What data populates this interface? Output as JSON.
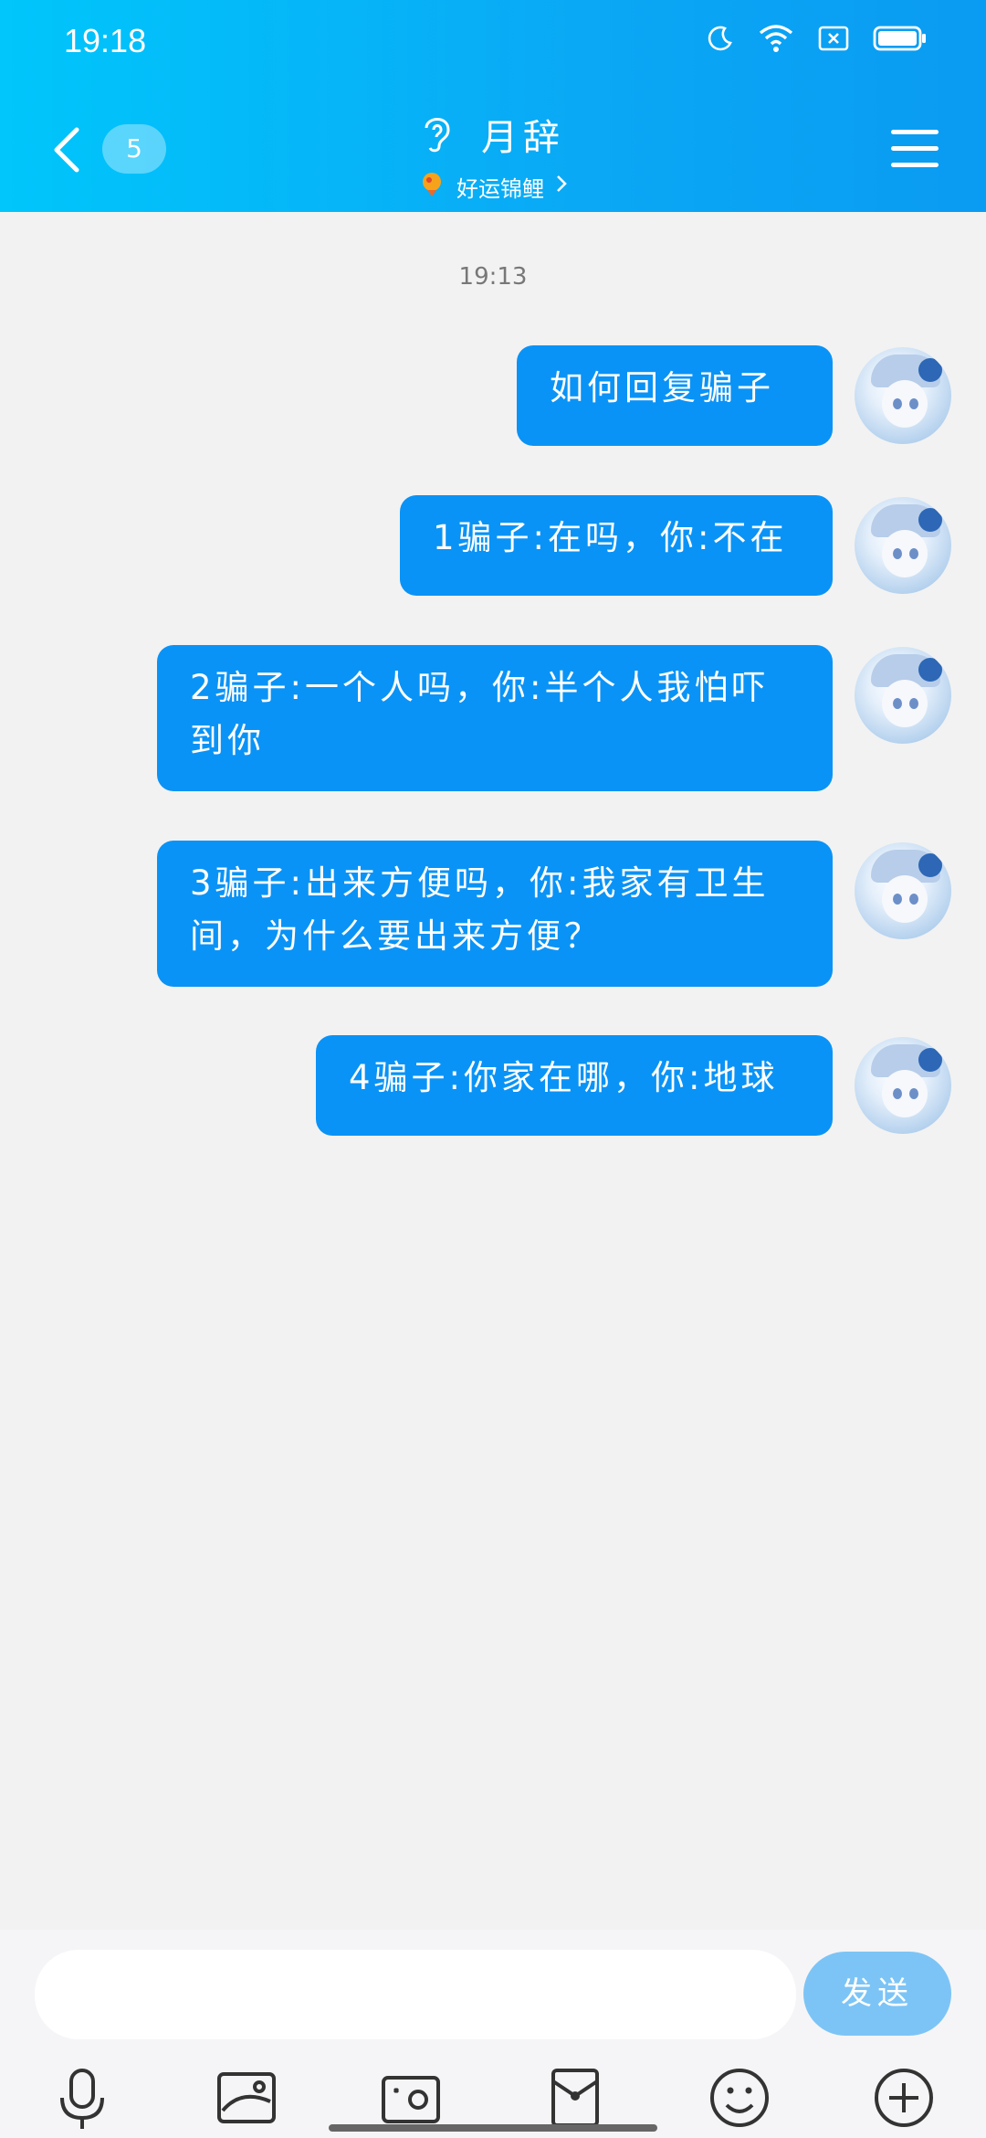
{
  "status": {
    "time": "19:18"
  },
  "header": {
    "unread_count": "5",
    "title": "月辞",
    "subtitle": "好运锦鲤"
  },
  "chat": {
    "timestamp": "19:13",
    "messages": [
      {
        "text": "如何回复骗子"
      },
      {
        "text": "1骗子:在吗，你:不在"
      },
      {
        "text": "2骗子:一个人吗，你:半个人我怕吓到你"
      },
      {
        "text": "3骗子:出来方便吗，你:我家有卫生间，为什么要出来方便？"
      },
      {
        "text": "4骗子:你家在哪，你:地球"
      }
    ]
  },
  "input": {
    "placeholder": "",
    "send_label": "发送"
  },
  "icons": {
    "status": [
      "moon-icon",
      "wifi-icon",
      "sim-off-icon",
      "battery-icon"
    ],
    "toolbar": [
      "microphone-icon",
      "image-icon",
      "camera-icon",
      "red-packet-icon",
      "emoji-icon",
      "plus-icon"
    ]
  },
  "colors": {
    "header_gradient_start": "#00c6fb",
    "header_gradient_end": "#0a9bf2",
    "bubble": "#0a93f6",
    "send_button": "#7cc4f6",
    "background": "#f2f2f2"
  }
}
